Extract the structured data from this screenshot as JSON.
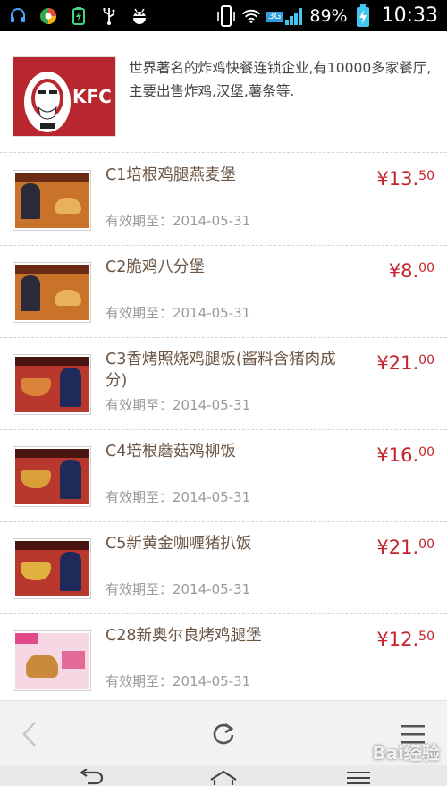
{
  "status_bar": {
    "battery_percent": "89%",
    "time": "10:33",
    "network_type": "3G",
    "icons_left": [
      "headset-icon",
      "browser-app-icon",
      "battery-saver-icon",
      "usb-icon",
      "android-debug-icon"
    ],
    "icons_right": [
      "vibrate-icon",
      "wifi-icon",
      "mobile-signal-icon",
      "battery-charging-icon"
    ]
  },
  "store": {
    "logo_text": "KFC",
    "description": "世界著名的炸鸡快餐连锁企业,有10000多家餐厅,主要出售炸鸡,汉堡,薯条等."
  },
  "coupons": [
    {
      "code_title": "C1培根鸡腿燕麦堡",
      "valid_until": "有效期至：2014-05-31",
      "price_main": "¥13.",
      "price_decimal": "50",
      "thumb_color": "#c8722a"
    },
    {
      "code_title": "C2脆鸡八分堡",
      "valid_until": "有效期至：2014-05-31",
      "price_main": "¥8.",
      "price_decimal": "00",
      "thumb_color": "#c8722a"
    },
    {
      "code_title": "C3香烤照烧鸡腿饭(酱料含猪肉成分)",
      "valid_until": "有效期至：2014-05-31",
      "price_main": "¥21.",
      "price_decimal": "00",
      "thumb_color": "#b8382e"
    },
    {
      "code_title": "C4培根蘑菇鸡柳饭",
      "valid_until": "有效期至：2014-05-31",
      "price_main": "¥16.",
      "price_decimal": "00",
      "thumb_color": "#b8382e"
    },
    {
      "code_title": "C5新黄金咖喱猪扒饭",
      "valid_until": "有效期至：2014-05-31",
      "price_main": "¥21.",
      "price_decimal": "00",
      "thumb_color": "#b8382e"
    },
    {
      "code_title": "C28新奥尔良烤鸡腿堡",
      "valid_until": "有效期至：2014-05-31",
      "price_main": "¥12.",
      "price_decimal": "50",
      "thumb_color": "#e46a9a"
    }
  ],
  "toolbar": {
    "back_icon": "chevron-left-icon",
    "refresh_icon": "refresh-icon",
    "menu_icon": "hamburger-menu-icon"
  },
  "watermark": {
    "text": "Bai经验"
  },
  "colors": {
    "price": "#c4232b",
    "title": "#6b5646",
    "valid": "#9a9a9a",
    "kfc_red": "#b8262e"
  }
}
